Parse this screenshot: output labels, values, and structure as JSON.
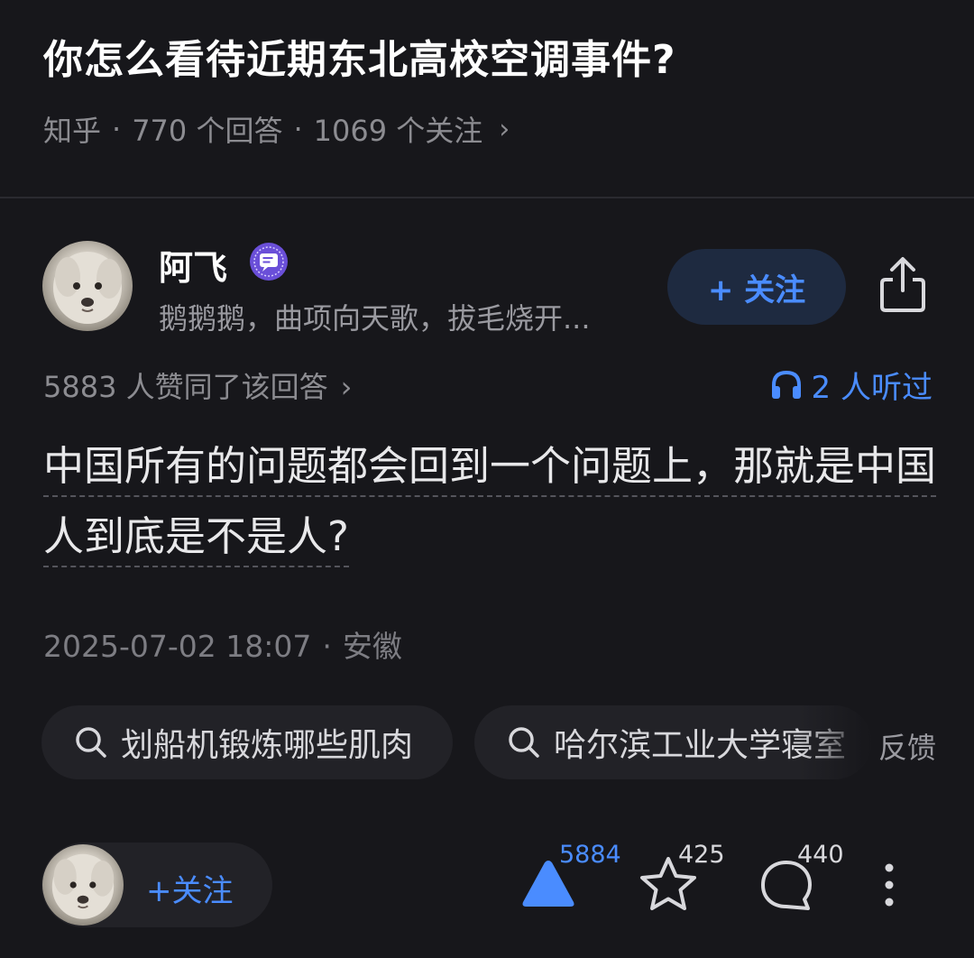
{
  "question": {
    "title": "你怎么看待近期东北高校空调事件?",
    "source": "知乎",
    "answers": "770 个回答",
    "follows": "1069 个关注"
  },
  "author": {
    "name": "阿飞",
    "bio": "鹅鹅鹅，曲项向天歌，拔毛烧开...",
    "follow_label": "+ 关注",
    "badge_icon": "chat-badge-icon",
    "share_icon": "share-icon"
  },
  "stats": {
    "likes_line": "5883 人赞同了该回答",
    "listened": "2 人听过"
  },
  "answer": {
    "text": "中国所有的问题都会回到一个问题上，那就是中国人到底是不是人?",
    "date": "2025-07-02 18:07",
    "location": "安徽"
  },
  "search_chips": [
    {
      "label": "划船机锻炼哪些肌肉"
    },
    {
      "label": "哈尔滨工业大学寝室"
    }
  ],
  "feedback_label": "反馈",
  "bottom_bar": {
    "follow_label": "+关注",
    "upvote_count": "5884",
    "favorite_count": "425",
    "comment_count": "440"
  },
  "colors": {
    "background": "#17171b",
    "accent": "#4a8cff",
    "muted": "#8c8c91"
  }
}
